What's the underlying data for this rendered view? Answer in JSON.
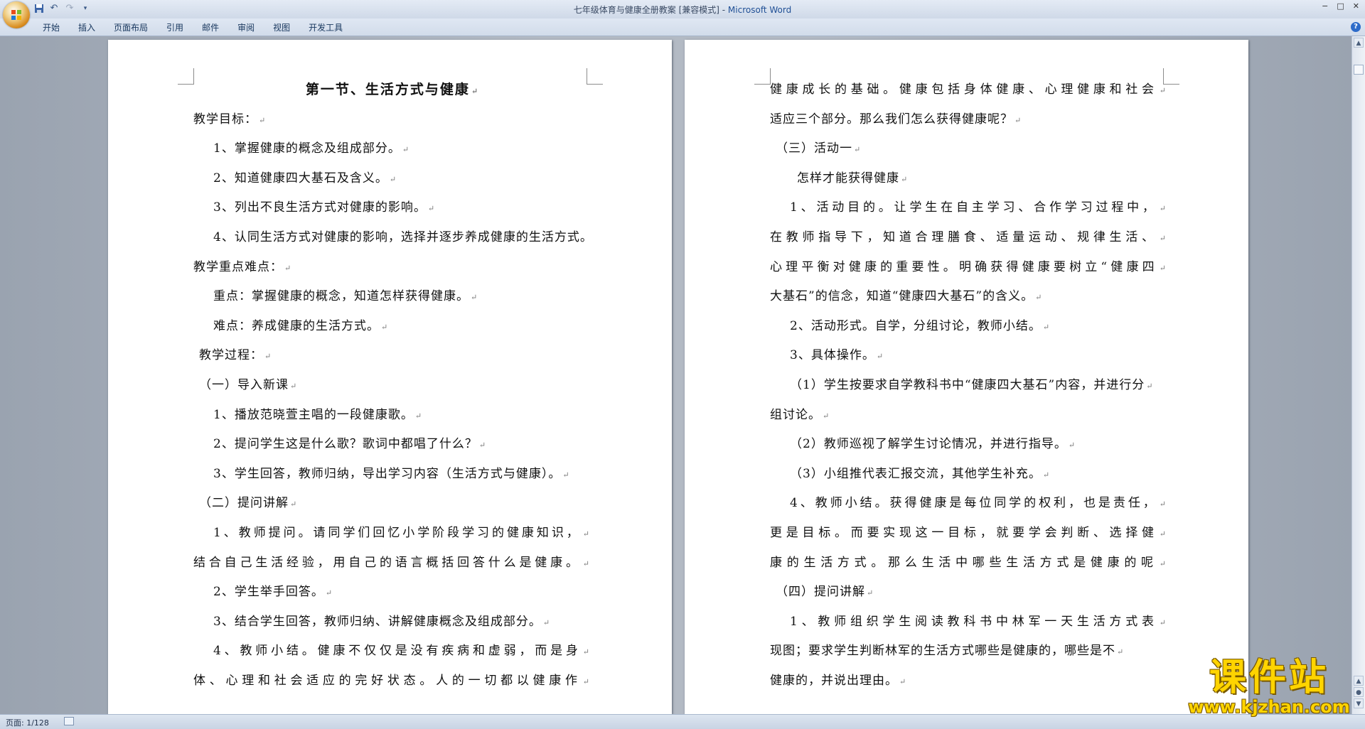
{
  "window": {
    "title": "七年级体育与健康全册教案 [兼容模式] - ",
    "app_name": "Microsoft Word",
    "minimize": "−",
    "maximize": "□",
    "close": "✕"
  },
  "quick_access": {
    "save_icon": "save-icon",
    "undo_icon": "undo-icon",
    "redo_icon": "redo-icon",
    "customize_icon": "dropdown-icon"
  },
  "ribbon": {
    "tabs": [
      "开始",
      "插入",
      "页面布局",
      "引用",
      "邮件",
      "审阅",
      "视图",
      "开发工具"
    ],
    "help": "?"
  },
  "left_page": {
    "lines": [
      "第一节、生活方式与健康",
      "教学目标：",
      "1、掌握健康的概念及组成部分。",
      "2、知道健康四大基石及含义。",
      "3、列出不良生活方式对健康的影响。",
      "4、认同生活方式对健康的影响，选择并逐步养成健康的生活方式。",
      "教学重点难点：",
      "重点：掌握健康的概念，知道怎样获得健康。",
      "难点：养成健康的生活方式。",
      "教学过程：",
      "（一）导入新课",
      "1、播放范晓萱主唱的一段健康歌。",
      "2、提问学生这是什么歌？歌词中都唱了什么？",
      "3、学生回答，教师归纳，导出学习内容（生活方式与健康）。",
      "（二）提问讲解",
      "1、教师提问。请同学们回忆小学阶段学习的健康知识，",
      "结合自己生活经验，用自己的语言概括回答什么是健康。",
      "2、学生举手回答。",
      "3、结合学生回答，教师归纳、讲解健康概念及组成部分。",
      "4、教师小结。健康不仅仅是没有疾病和虚弱，而是身",
      "体、心理和社会适应的完好状态。人的一切都以健康作"
    ]
  },
  "right_page": {
    "lines": [
      "健康成长的基础。健康包括身体健康、心理健康和社会",
      "适应三个部分。那么我们怎么获得健康呢？",
      "（三）活动一",
      "怎样才能获得健康",
      "1、活动目的。让学生在自主学习、合作学习过程中，",
      "在教师指导下，知道合理膳食、适量运动、规律生活、",
      "心理平衡对健康的重要性。明确获得健康要树立“健康四",
      "大基石”的信念，知道“健康四大基石”的含义。",
      "2、活动形式。自学，分组讨论，教师小结。",
      "3、具体操作。",
      "（1）学生按要求自学教科书中“健康四大基石”内容，并进行分",
      "组讨论。",
      "（2）教师巡视了解学生讨论情况，并进行指导。",
      "（3）小组推代表汇报交流，其他学生补充。",
      "4、教师小结。获得健康是每位同学的权利，也是责任，",
      "更是目标。而要实现这一目标，就要学会判断、选择健",
      "康的生活方式。那么生活中哪些生活方式是健康的呢",
      "（四）提问讲解",
      "1、教师组织学生阅读教科书中林军一天生活方式表",
      "现图；要求学生判断林军的生活方式哪些是健康的，哪些是不",
      "健康的，并说出理由。"
    ]
  },
  "paragraph_mark": "↵",
  "status": {
    "page": "页面: 1/128"
  },
  "watermark": {
    "line1": "课件站",
    "line2": "www.kjzhan.com"
  },
  "colors": {
    "accent": "#1f4f95",
    "watermark": "#ffd400"
  }
}
